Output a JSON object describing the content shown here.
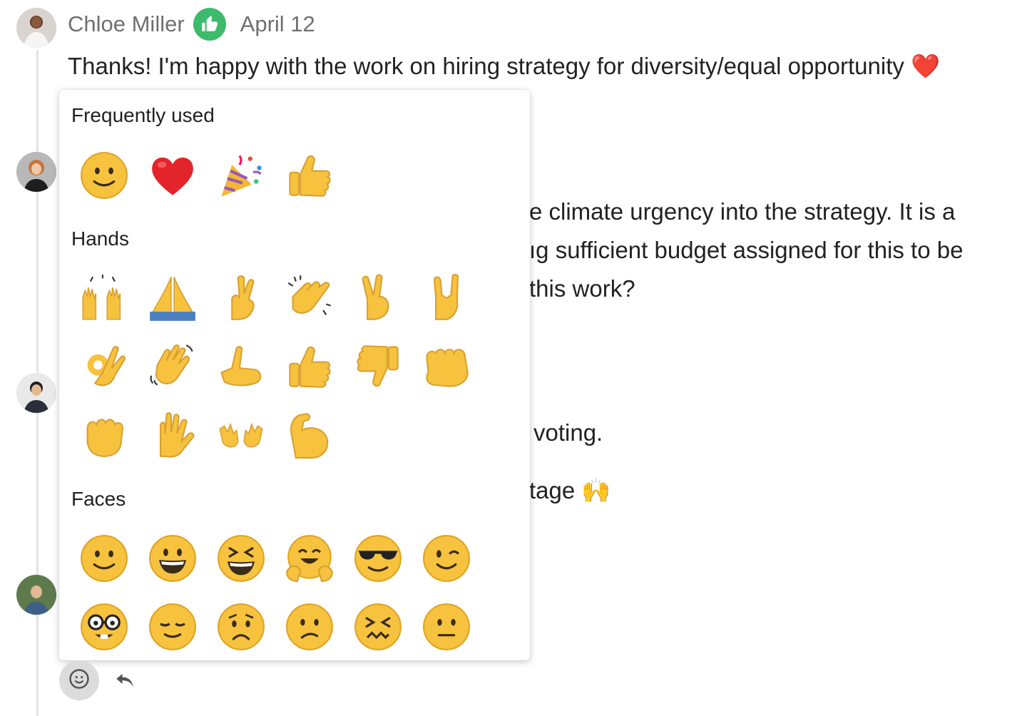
{
  "message": {
    "author": "Chloe Miller",
    "date": "April 12",
    "text": "Thanks! I'm happy with the work on hiring strategy for diversity/equal opportunity",
    "trailing_emoji": "❤️",
    "badge_icon": "thumbs-up-icon"
  },
  "background_lines": [
    "e climate urgency into the strategy. It is a",
    "ıg sufficient budget assigned for this to be",
    "this work?",
    "voting.",
    "tage 🙌"
  ],
  "picker": {
    "sections": [
      {
        "title": "Frequently used",
        "emojis": [
          "slightly-smiling-face",
          "red-heart",
          "party-popper",
          "thumbs-up"
        ]
      },
      {
        "title": "Hands",
        "emojis": [
          "raising-hands",
          "folded-hands",
          "crossed-fingers",
          "clapping-hands",
          "victory-hand",
          "sign-of-the-horns",
          "ok-hand",
          "waving-hand",
          "call-me-hand",
          "thumbs-up",
          "thumbs-down",
          "oncoming-fist",
          "raised-fist",
          "raised-hand",
          "open-hands",
          "flexed-biceps"
        ]
      },
      {
        "title": "Faces",
        "emojis": [
          "slightly-smiling-face",
          "grinning-face",
          "grinning-squinting-face",
          "hugging-face",
          "smiling-face-with-sunglasses",
          "winking-face",
          "nerd-face",
          "relieved-face",
          "worried-face",
          "confused-face",
          "confounded-face",
          "neutral-face"
        ]
      }
    ]
  },
  "toolbar": {
    "emoji_button_icon": "smiley-icon",
    "reply_button_icon": "reply-icon"
  },
  "colors": {
    "badge": "#3dbb6c",
    "thread_line": "#e3e3e3",
    "emoji_yellow": "#f7c33f"
  }
}
